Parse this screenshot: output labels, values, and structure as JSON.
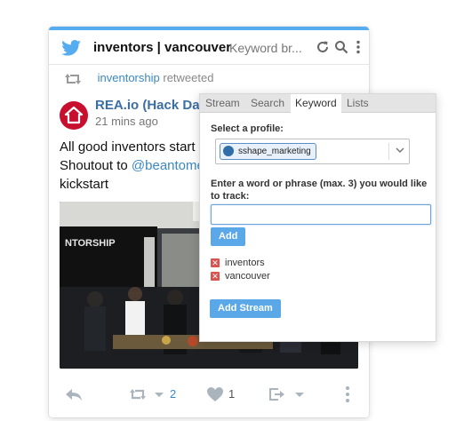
{
  "column": {
    "title": "inventors | vancouver",
    "subtitle": "Keyword br...",
    "icons": [
      "twitter-bird-icon",
      "refresh-icon",
      "search-icon",
      "more-icon"
    ]
  },
  "tweet": {
    "retweeted_by": "inventorship",
    "retweeted_label": "retweeted",
    "author": "REA.io (Hack Day)",
    "time": "21 mins ago",
    "text_line1": "All good inventors start t",
    "text_line2_prefix": "Shoutout to ",
    "mention": "@beantome",
    "text_line3": "kickstart",
    "photo_text": "NTORSHIP",
    "actions": {
      "retweet_count": "2",
      "like_count": "1"
    }
  },
  "stream_panel": {
    "tabs": [
      "Stream",
      "Search",
      "Keyword",
      "Lists"
    ],
    "active_tab": "Keyword",
    "profile_label": "Select a profile:",
    "profile_value": "sshape_marketing",
    "track_label": "Enter a word or phrase (max. 3) you would like to track:",
    "track_input_value": "",
    "add_button": "Add",
    "keywords": [
      "inventors",
      "vancouver"
    ],
    "add_stream_button": "Add Stream"
  },
  "colors": {
    "accent": "#55acee",
    "link": "#3b88c3",
    "button": "#5aa8e8",
    "remove": "#d9534f"
  }
}
